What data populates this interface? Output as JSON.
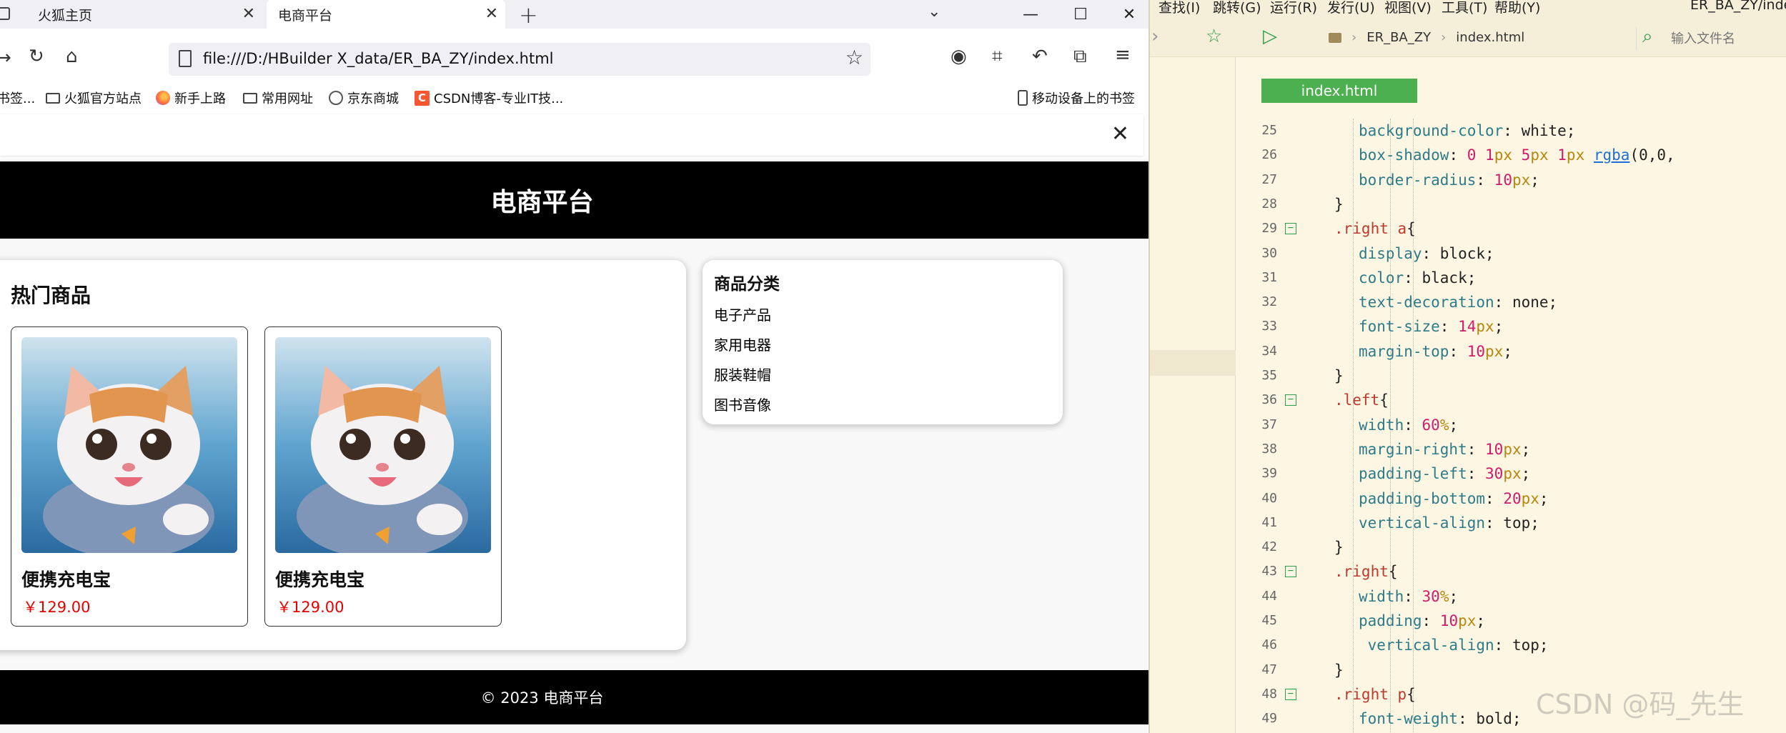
{
  "browser": {
    "tabs": [
      {
        "label": "火狐主页"
      },
      {
        "label": "电商平台"
      }
    ],
    "url": "file:///D:/HBuilder X_data/ER_BA_ZY/index.html",
    "bookmarks": [
      {
        "label": "书签..."
      },
      {
        "label": "火狐官方站点"
      },
      {
        "label": "新手上路"
      },
      {
        "label": "常用网址"
      },
      {
        "label": "京东商城"
      },
      {
        "label": "CSDN博客-专业IT技..."
      },
      {
        "label": "移动设备上的书签"
      }
    ],
    "icons": {
      "back": "arrow-left",
      "reload": "reload",
      "home": "home",
      "star": "star",
      "account": "account",
      "crop": "screenshot",
      "undo": "undo",
      "extensions": "extensions",
      "menu": "hamburger"
    }
  },
  "page": {
    "header_title": "电商平台",
    "hot_title": "热门商品",
    "products": [
      {
        "name": "便携充电宝",
        "price": "￥129.00"
      },
      {
        "name": "便携充电宝",
        "price": "￥129.00"
      }
    ],
    "category_title": "商品分类",
    "categories": [
      "电子产品",
      "家用电器",
      "服装鞋帽",
      "图书音像"
    ],
    "footer": "© 2023 电商平台",
    "colors": {
      "header_bg": "#000000",
      "price": "#e60000"
    }
  },
  "editor": {
    "menu": [
      "查找(I)",
      "跳转(G)",
      "运行(R)",
      "发行(U)",
      "视图(V)",
      "工具(T)",
      "帮助(Y)",
      "ER_BA_ZY/inde"
    ],
    "breadcrumbs": [
      "ER_BA_ZY",
      "index.html"
    ],
    "search_placeholder": "输入文件名",
    "active_file": "index.html",
    "watermark": "CSDN @码_先生",
    "accent": "#4caf50",
    "lines": [
      {
        "n": "25",
        "text": "background-color: white;"
      },
      {
        "n": "26",
        "text": "box-shadow: 0 1px 5px 1px rgba(0,0,"
      },
      {
        "n": "27",
        "text": "border-radius: 10px;"
      },
      {
        "n": "28",
        "text": "}"
      },
      {
        "n": "29",
        "text": ".right a{"
      },
      {
        "n": "30",
        "text": "display: block;"
      },
      {
        "n": "31",
        "text": "color: black;"
      },
      {
        "n": "32",
        "text": "text-decoration: none;"
      },
      {
        "n": "33",
        "text": "font-size: 14px;"
      },
      {
        "n": "34",
        "text": "margin-top: 10px;"
      },
      {
        "n": "35",
        "text": "}"
      },
      {
        "n": "36",
        "text": ".left{"
      },
      {
        "n": "37",
        "text": "width: 60%;"
      },
      {
        "n": "38",
        "text": "margin-right: 10px;"
      },
      {
        "n": "39",
        "text": "padding-left: 30px;"
      },
      {
        "n": "40",
        "text": "padding-bottom: 20px;"
      },
      {
        "n": "41",
        "text": "vertical-align: top;"
      },
      {
        "n": "42",
        "text": "}"
      },
      {
        "n": "43",
        "text": ".right{"
      },
      {
        "n": "44",
        "text": "width: 30%;"
      },
      {
        "n": "45",
        "text": "padding: 10px;"
      },
      {
        "n": "46",
        "text": " vertical-align: top;"
      },
      {
        "n": "47",
        "text": "}"
      },
      {
        "n": "48",
        "text": ".right p{"
      },
      {
        "n": "49",
        "text": "font-weight: bold;"
      }
    ]
  }
}
